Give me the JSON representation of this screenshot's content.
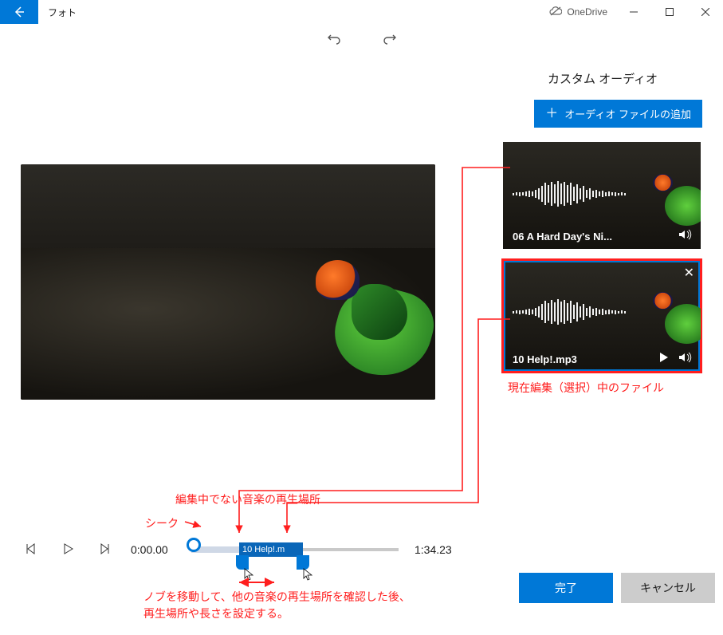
{
  "titlebar": {
    "app_name": "フォト",
    "onedrive_label": "OneDrive"
  },
  "panel": {
    "title": "カスタム オーディオ",
    "add_audio_label": "オーディオ ファイルの追加"
  },
  "audio_clips": [
    {
      "label": "06 A Hard Day's Ni..."
    },
    {
      "label": "10 Help!.mp3"
    }
  ],
  "annotations": {
    "selected_file": "現在編集（選択）中のファイル",
    "other_music_pos": "編集中でない音楽の再生場所",
    "seek": "シーク",
    "knob_help_line1": "ノブを移動して、他の音楽の再生場所を確認した後、",
    "knob_help_line2": "再生場所や長さを設定する。"
  },
  "timeline": {
    "current": "0:00.00",
    "total": "1:34.23",
    "clip_label": "10 Help!.m"
  },
  "footer": {
    "done": "完了",
    "cancel": "キャンセル"
  }
}
